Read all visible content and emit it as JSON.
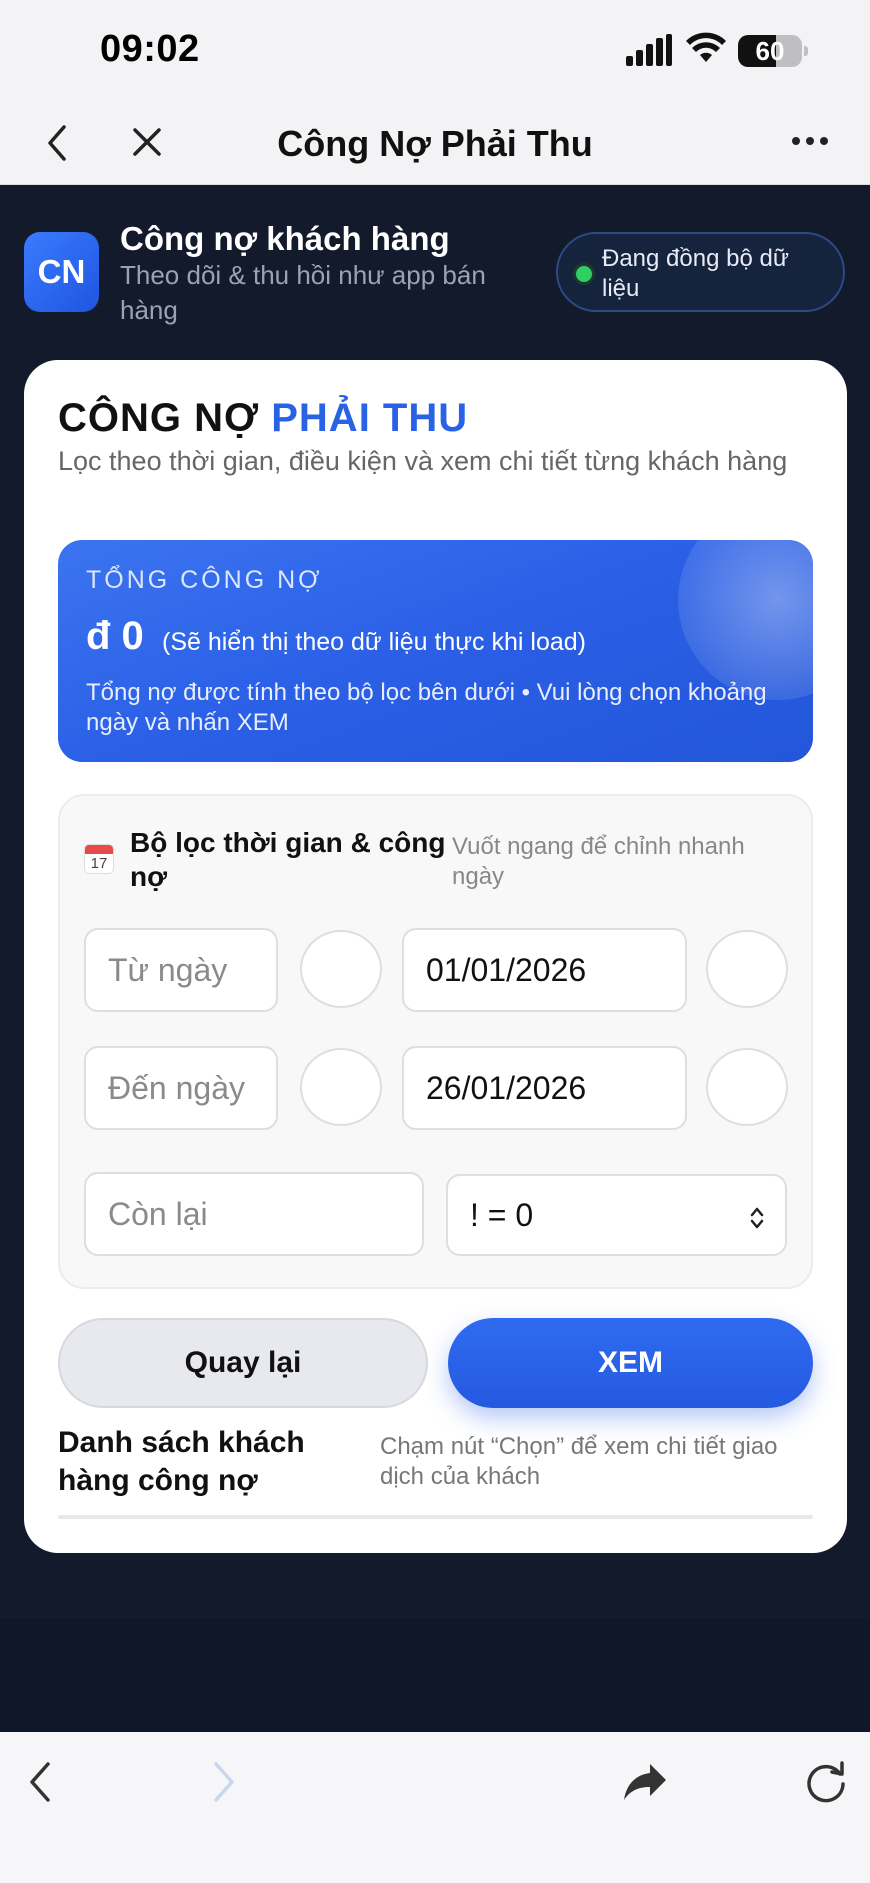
{
  "status_bar": {
    "time": "09:02",
    "battery": "60",
    "battery_level": 0.6
  },
  "nav": {
    "title": "Công Nợ Phải Thu"
  },
  "app_header": {
    "logo": "CN",
    "title": "Công nợ khách hàng",
    "subtitle": "Theo dõi & thu hồi như app bán hàng",
    "sync_status": "Đang đồng bộ dữ liệu"
  },
  "card": {
    "title_part1": "CÔNG NỢ ",
    "title_part2": "PHẢI THU",
    "subtitle": "Lọc theo thời gian, điều kiện và xem chi tiết từng khách hàng",
    "total": {
      "label": "TỔNG CÔNG NỢ",
      "amount": "đ 0",
      "note": "(Sẽ hiển thị theo dữ liệu thực khi load)",
      "desc": "Tổng nợ được tính theo bộ lọc bên dưới • Vui lòng chọn khoảng ngày và nhấn XEM"
    },
    "filter": {
      "calendar_day": "17",
      "title": "Bộ lọc thời gian & công nợ",
      "hint": "Vuốt ngang để chỉnh nhanh ngày",
      "from_label": "Từ ngày",
      "from_value": "01/01/2026",
      "to_label": "Đến ngày",
      "to_value": "26/01/2026",
      "remaining_label": "Còn lại",
      "condition_value": "! = 0"
    },
    "buttons": {
      "back": "Quay lại",
      "view": "XEM"
    },
    "list": {
      "title": "Danh sách khách hàng công nợ",
      "hint": "Chạm nút “Chọn” để xem chi tiết giao dịch của khách"
    }
  },
  "colors": {
    "accent": "#2a62e6",
    "dark_bg": "#121a2b",
    "sync_dot": "#2fcf63"
  },
  "icons": [
    "signal-icon",
    "wifi-icon",
    "battery-icon",
    "back-chevron-icon",
    "close-icon",
    "more-icon",
    "calendar-icon",
    "select-arrows-icon",
    "browser-back-icon",
    "browser-forward-icon",
    "share-icon",
    "reload-icon"
  ]
}
